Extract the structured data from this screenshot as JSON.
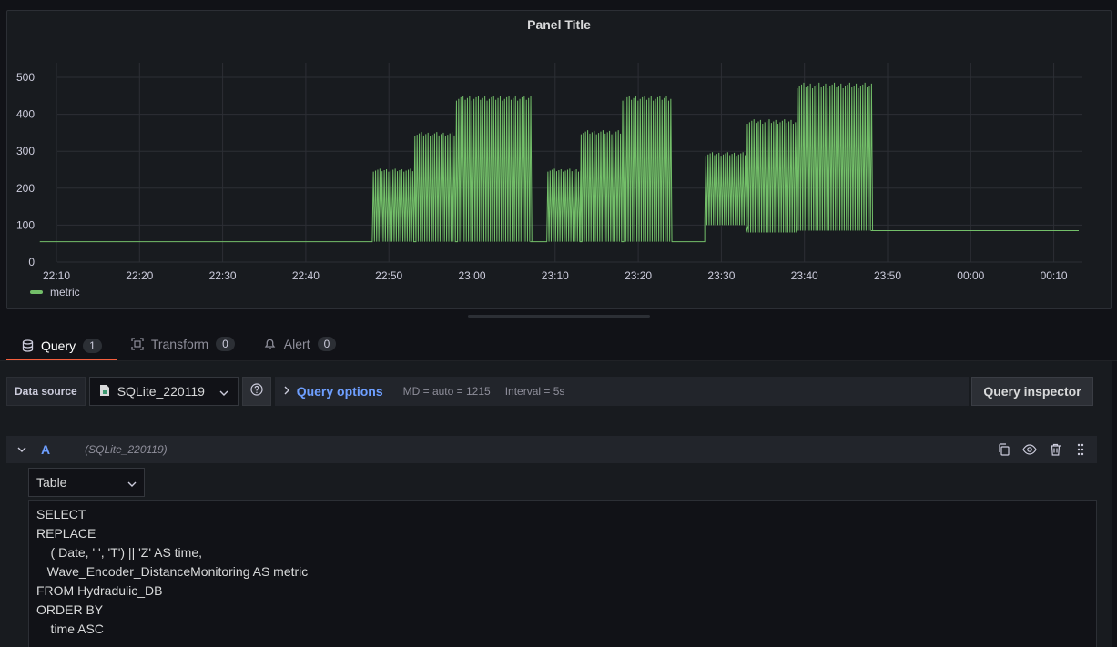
{
  "panel": {
    "title": "Panel Title"
  },
  "chart_data": {
    "type": "line",
    "title": "Panel Title",
    "ylim": [
      0,
      520
    ],
    "yticks": [
      "0",
      "100",
      "200",
      "300",
      "400",
      "500"
    ],
    "xticks": [
      "22:10",
      "22:20",
      "22:30",
      "22:40",
      "22:50",
      "23:00",
      "23:10",
      "23:20",
      "23:30",
      "23:40",
      "23:50",
      "00:00",
      "00:10"
    ],
    "grid": true,
    "legend_position": "bottom-left",
    "series": [
      {
        "name": "metric",
        "color": "#73bf69",
        "segments": [
          {
            "from": "22:08",
            "to": "22:48",
            "low": 55,
            "high": 55
          },
          {
            "from": "22:48",
            "to": "22:53",
            "low": 55,
            "high": 255
          },
          {
            "from": "22:53",
            "to": "22:58",
            "low": 55,
            "high": 355
          },
          {
            "from": "22:58",
            "to": "23:07",
            "low": 55,
            "high": 455
          },
          {
            "from": "23:07",
            "to": "23:09",
            "low": 55,
            "high": 55
          },
          {
            "from": "23:09",
            "to": "23:13",
            "low": 55,
            "high": 255
          },
          {
            "from": "23:13",
            "to": "23:18",
            "low": 55,
            "high": 360
          },
          {
            "from": "23:18",
            "to": "23:24",
            "low": 55,
            "high": 455
          },
          {
            "from": "23:24",
            "to": "23:28",
            "low": 55,
            "high": 55
          },
          {
            "from": "23:28",
            "to": "23:33",
            "low": 100,
            "high": 300
          },
          {
            "from": "23:33",
            "to": "23:39",
            "low": 80,
            "high": 390
          },
          {
            "from": "23:39",
            "to": "23:48",
            "low": 85,
            "high": 490
          },
          {
            "from": "23:48",
            "to": "00:13",
            "low": 85,
            "high": 85
          }
        ]
      }
    ]
  },
  "legend": {
    "label": "metric"
  },
  "tabs": [
    {
      "label": "Query",
      "count": "1"
    },
    {
      "label": "Transform",
      "count": "0"
    },
    {
      "label": "Alert",
      "count": "0"
    }
  ],
  "datasource": {
    "label": "Data source",
    "selected": "SQLite_220119"
  },
  "query_options": {
    "title": "Query options",
    "md": "MD = auto = 1215",
    "interval": "Interval = 5s"
  },
  "query_inspector": "Query inspector",
  "query": {
    "letter": "A",
    "datasource": "(SQLite_220119)",
    "format": "Table",
    "sql": "SELECT\nREPLACE\n    ( Date, ' ', 'T') || 'Z' AS time,\n   Wave_Encoder_DistanceMonitoring AS metric\nFROM Hydradulic_DB\nORDER BY\n    time ASC"
  }
}
